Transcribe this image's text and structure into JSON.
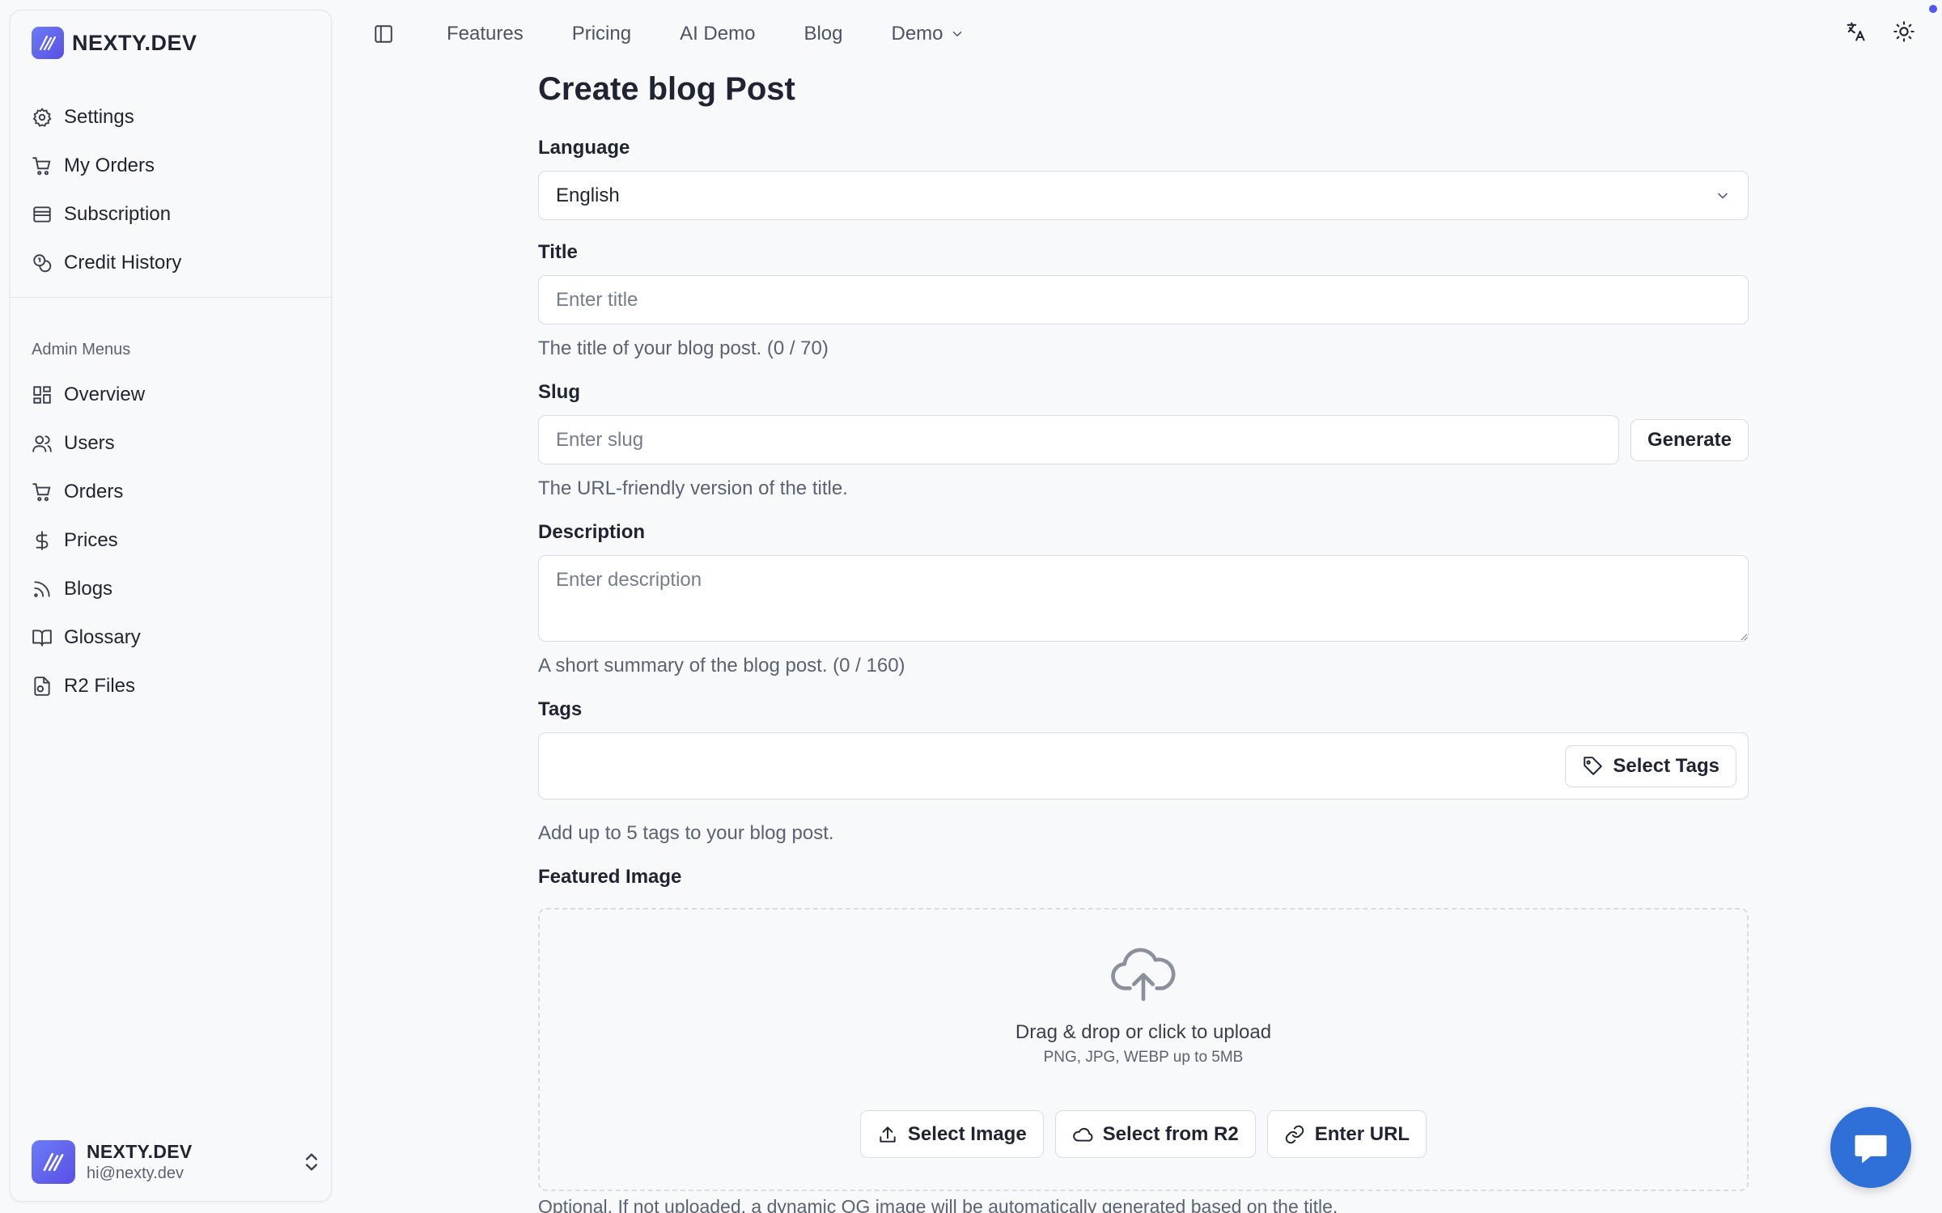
{
  "brand": {
    "name": "NEXTY.DEV",
    "accent": "#5a4fe6"
  },
  "sidebar": {
    "user_items": [
      {
        "label": "Settings",
        "icon": "gear-icon"
      },
      {
        "label": "My Orders",
        "icon": "cart-icon"
      },
      {
        "label": "Subscription",
        "icon": "card-icon"
      },
      {
        "label": "Credit History",
        "icon": "coins-icon"
      }
    ],
    "admin_label": "Admin Menus",
    "admin_items": [
      {
        "label": "Overview",
        "icon": "grid-icon"
      },
      {
        "label": "Users",
        "icon": "users-icon"
      },
      {
        "label": "Orders",
        "icon": "cart-icon"
      },
      {
        "label": "Prices",
        "icon": "dollar-icon"
      },
      {
        "label": "Blogs",
        "icon": "rss-icon"
      },
      {
        "label": "Glossary",
        "icon": "book-icon"
      },
      {
        "label": "R2 Files",
        "icon": "file-icon"
      }
    ],
    "user": {
      "name": "NEXTY.DEV",
      "email": "hi@nexty.dev"
    }
  },
  "topnav": {
    "links": [
      "Features",
      "Pricing",
      "AI Demo",
      "Blog"
    ],
    "demo_label": "Demo"
  },
  "form": {
    "title": "Create blog Post",
    "language": {
      "label": "Language",
      "value": "English"
    },
    "post_title": {
      "label": "Title",
      "placeholder": "Enter title",
      "help": "The title of your blog post. (0 / 70)"
    },
    "slug": {
      "label": "Slug",
      "placeholder": "Enter slug",
      "button": "Generate",
      "help": "The URL-friendly version of the title."
    },
    "description": {
      "label": "Description",
      "placeholder": "Enter description",
      "help": "A short summary of the blog post. (0 / 160)"
    },
    "tags": {
      "label": "Tags",
      "button": "Select Tags",
      "help": "Add up to 5 tags to your blog post."
    },
    "featured_image": {
      "label": "Featured Image",
      "drop_title": "Drag & drop or click to upload",
      "drop_sub": "PNG, JPG, WEBP up to 5MB",
      "select_image": "Select Image",
      "select_r2": "Select from R2",
      "enter_url": "Enter URL",
      "footnote": "Optional. If not uploaded, a dynamic OG image will be automatically generated based on the title."
    }
  }
}
